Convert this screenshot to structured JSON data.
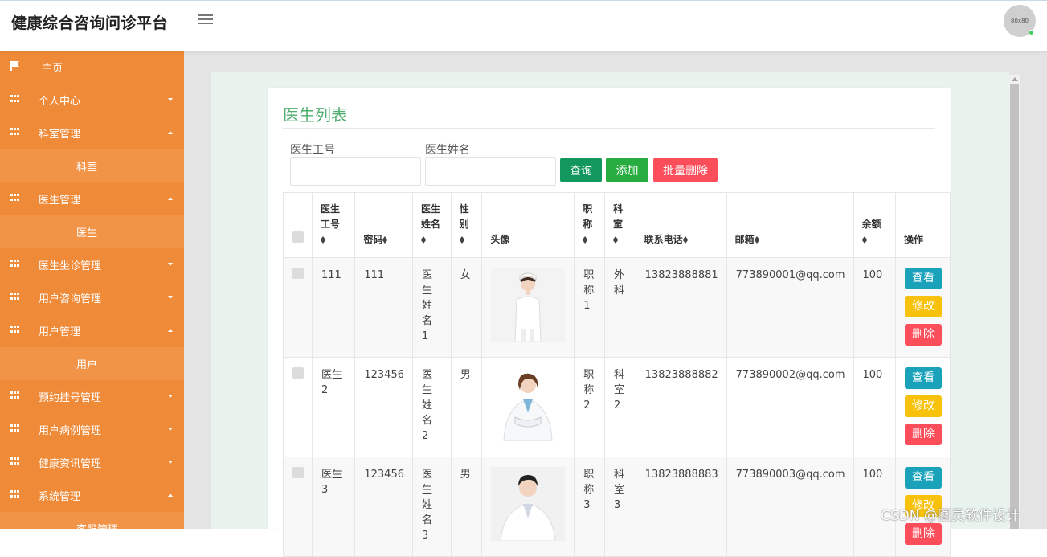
{
  "app": {
    "title": "健康综合咨询问诊平台",
    "avatar_text": "80x80"
  },
  "sidebar": {
    "items": [
      {
        "label": "主页",
        "type": "home",
        "icon": "flag-icon"
      },
      {
        "label": "个人中心",
        "type": "parent",
        "caret": "down",
        "icon": "grid-icon"
      },
      {
        "label": "科室管理",
        "type": "parent",
        "caret": "up",
        "icon": "grid-icon"
      },
      {
        "label": "科室",
        "type": "child"
      },
      {
        "label": "医生管理",
        "type": "parent",
        "caret": "up",
        "icon": "grid-icon"
      },
      {
        "label": "医生",
        "type": "child"
      },
      {
        "label": "医生坐诊管理",
        "type": "parent",
        "caret": "down",
        "icon": "grid-icon"
      },
      {
        "label": "用户咨询管理",
        "type": "parent",
        "caret": "down",
        "icon": "grid-icon"
      },
      {
        "label": "用户管理",
        "type": "parent",
        "caret": "up",
        "icon": "grid-icon"
      },
      {
        "label": "用户",
        "type": "child"
      },
      {
        "label": "预约挂号管理",
        "type": "parent",
        "caret": "down",
        "icon": "grid-icon"
      },
      {
        "label": "用户病例管理",
        "type": "parent",
        "caret": "down",
        "icon": "grid-icon"
      },
      {
        "label": "健康资讯管理",
        "type": "parent",
        "caret": "down",
        "icon": "grid-icon"
      },
      {
        "label": "系统管理",
        "type": "parent",
        "caret": "up",
        "icon": "grid-icon"
      },
      {
        "label": "客服管理",
        "type": "child"
      }
    ]
  },
  "page": {
    "title": "医生列表",
    "search": {
      "field1_label": "医生工号",
      "field1_value": "",
      "field2_label": "医生姓名",
      "field2_value": ""
    },
    "buttons": {
      "query": "查询",
      "add": "添加",
      "batch_delete": "批量删除"
    },
    "table": {
      "headers": {
        "id": "医生\n工号",
        "password": "密码",
        "name": "医生\n姓名",
        "gender": "性\n别",
        "photo": "头像",
        "title": "职\n称",
        "dept": "科\n室",
        "phone": "联系电话",
        "email": "邮箱",
        "balance": "余额",
        "ops": "操作"
      },
      "rows": [
        {
          "id": "111",
          "password": "111",
          "name": "医生\n姓名\n1",
          "gender": "女",
          "title": "职\n称\n1",
          "dept": "外\n科",
          "phone": "13823888881",
          "email": "773890001@qq.com",
          "balance": "100"
        },
        {
          "id": "医生\n2",
          "password": "123456",
          "name": "医生\n姓名\n2",
          "gender": "男",
          "title": "职\n称\n2",
          "dept": "科\n室\n2",
          "phone": "13823888882",
          "email": "773890002@qq.com",
          "balance": "100"
        },
        {
          "id": "医生\n3",
          "password": "123456",
          "name": "医生\n姓名\n3",
          "gender": "男",
          "title": "职\n称\n3",
          "dept": "科\n室\n3",
          "phone": "13823888883",
          "email": "773890003@qq.com",
          "balance": "100"
        }
      ],
      "ops": {
        "view": "查看",
        "edit": "修改",
        "delete": "删除"
      }
    }
  },
  "colors": {
    "sidebar": "#ef8a38",
    "sidebar_child": "#f19447",
    "title": "#4fae6f",
    "query": "#12985e",
    "add": "#27ad3f",
    "danger": "#fb4d5a",
    "view": "#1aa2bb",
    "edit": "#f8c10b"
  },
  "watermark": "CSDN @图灵软件设计"
}
